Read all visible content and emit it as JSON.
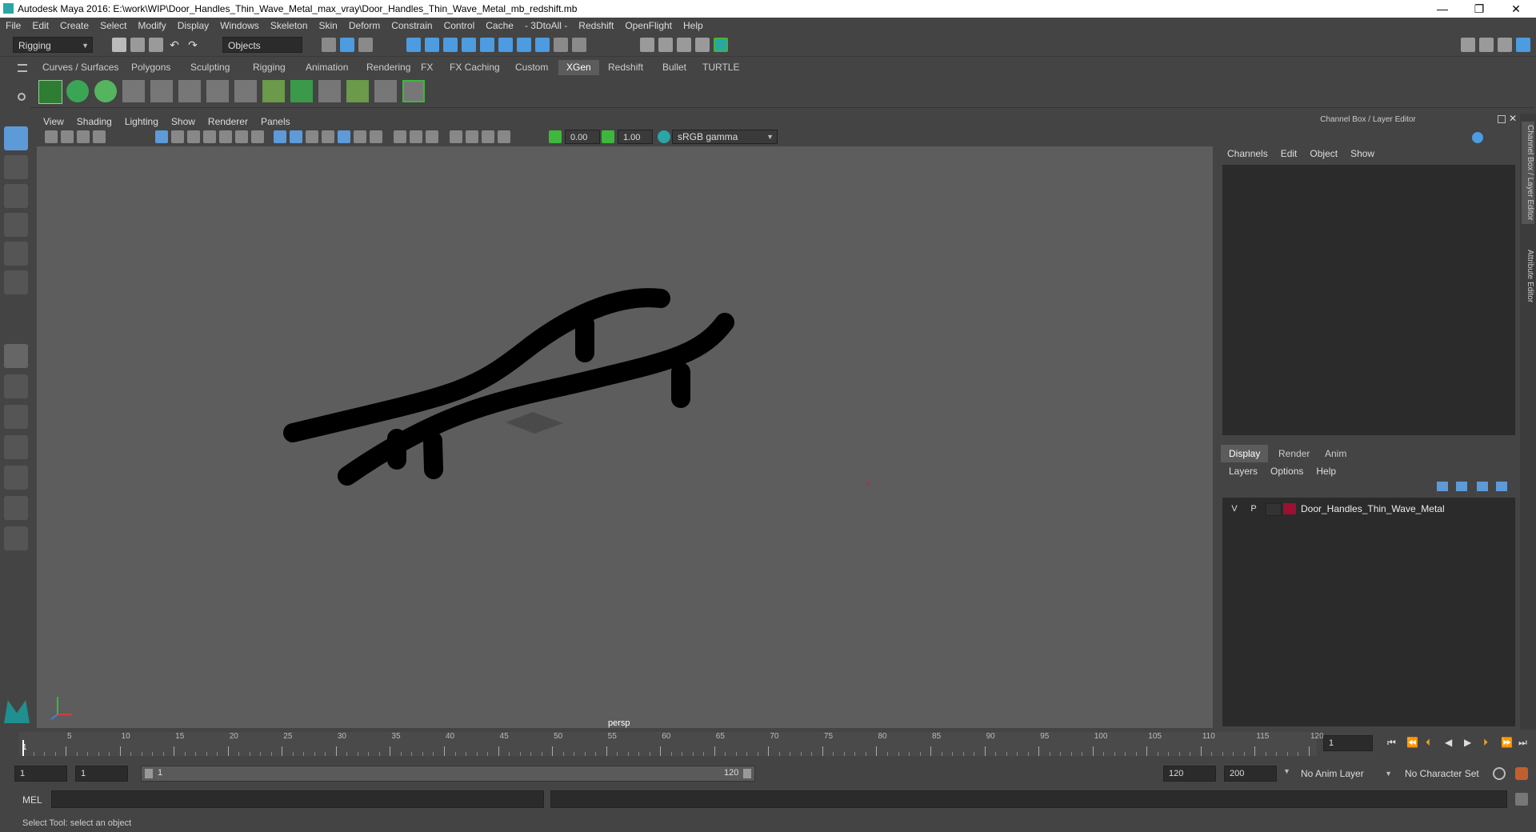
{
  "window": {
    "title": "Autodesk Maya 2016: E:\\work\\WIP\\Door_Handles_Thin_Wave_Metal_max_vray\\Door_Handles_Thin_Wave_Metal_mb_redshift.mb",
    "minimize": "—",
    "restore": "❐",
    "close": "✕"
  },
  "menubar": [
    "File",
    "Edit",
    "Create",
    "Select",
    "Modify",
    "Display",
    "Windows",
    "Skeleton",
    "Skin",
    "Deform",
    "Constrain",
    "Control",
    "Cache",
    "- 3DtoAll -",
    "Redshift",
    "OpenFlight",
    "Help"
  ],
  "statusline": {
    "mode": "Rigging",
    "selection_mode": "Objects"
  },
  "shelf": {
    "tabs": [
      "Curves / Surfaces",
      "Polygons",
      "Sculpting",
      "Rigging",
      "Animation",
      "Rendering",
      "FX",
      "FX Caching",
      "Custom",
      "XGen",
      "Redshift",
      "Bullet",
      "TURTLE"
    ],
    "active_tab": "XGen"
  },
  "viewport": {
    "menu": [
      "View",
      "Shading",
      "Lighting",
      "Show",
      "Renderer",
      "Panels"
    ],
    "exposure": "0.00",
    "gamma": "1.00",
    "color_space": "sRGB gamma",
    "camera": "persp"
  },
  "channel_box": {
    "title": "Channel Box / Layer Editor",
    "menu": [
      "Channels",
      "Edit",
      "Object",
      "Show"
    ]
  },
  "layer_editor": {
    "tabs": [
      "Display",
      "Render",
      "Anim"
    ],
    "active_tab": "Display",
    "menu": [
      "Layers",
      "Options",
      "Help"
    ],
    "layers": [
      {
        "visible": "V",
        "playback": "P",
        "name": "Door_Handles_Thin_Wave_Metal",
        "color": "#9b1030"
      }
    ]
  },
  "side_tabs": [
    "Channel Box / Layer Editor",
    "Attribute Editor"
  ],
  "timeline": {
    "ticks": [
      "5",
      "10",
      "15",
      "20",
      "25",
      "30",
      "35",
      "40",
      "45",
      "50",
      "55",
      "60",
      "65",
      "70",
      "75",
      "80",
      "85",
      "90",
      "95",
      "100",
      "105",
      "110",
      "115",
      "120"
    ],
    "start_label": "1",
    "current_frame": "1"
  },
  "range": {
    "start": "1",
    "playback_start": "1",
    "slider_start": "1",
    "slider_end": "120",
    "playback_end": "120",
    "end": "200",
    "anim_layer": "No Anim Layer",
    "character_set": "No Character Set"
  },
  "command_line": {
    "label": "MEL"
  },
  "help_line": {
    "text": "Select Tool: select an object"
  },
  "colors": {
    "accent": "#4d9be0",
    "active_green": "#3db83d",
    "layer_red": "#9b1030"
  }
}
